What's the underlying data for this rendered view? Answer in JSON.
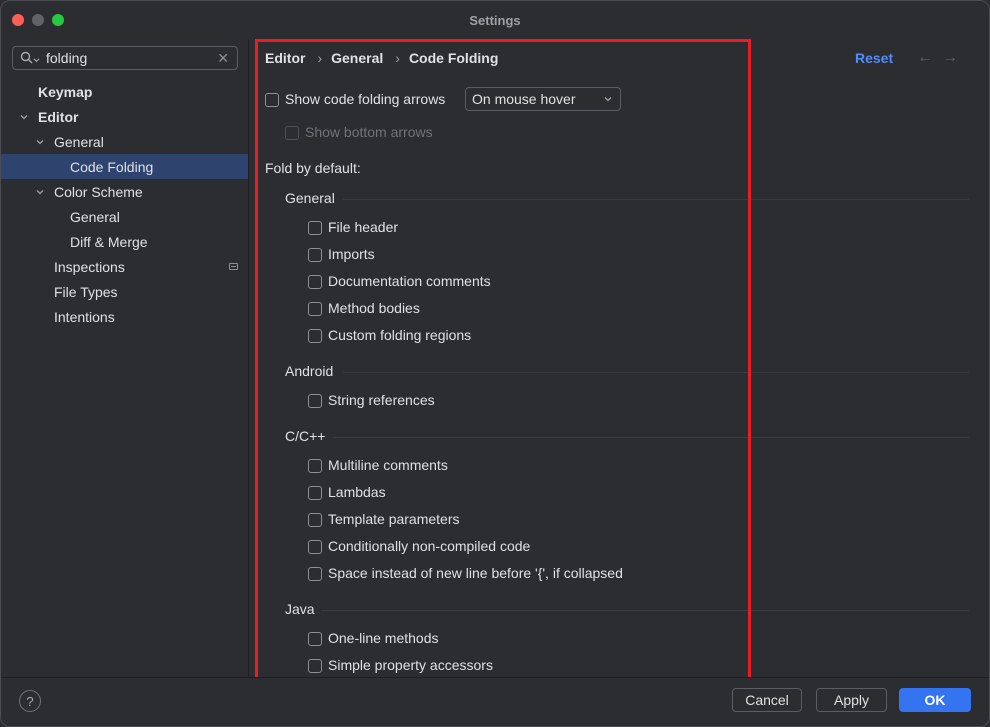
{
  "window": {
    "title": "Settings"
  },
  "colors": {
    "close": "#ff5f57",
    "minimize": "#5f6266",
    "zoom": "#28c840",
    "accent": "#3574f0",
    "selection": "#2e436e",
    "highlight": "#ec1c24"
  },
  "search": {
    "value": "folding",
    "placeholder": ""
  },
  "sidebar": {
    "items": [
      {
        "label": "Keymap"
      },
      {
        "label": "Editor"
      },
      {
        "label": "General"
      },
      {
        "label": "Code Folding"
      },
      {
        "label": "Color Scheme"
      },
      {
        "label": "General"
      },
      {
        "label": "Diff & Merge"
      },
      {
        "label": "Inspections"
      },
      {
        "label": "File Types"
      },
      {
        "label": "Intentions"
      }
    ]
  },
  "breadcrumb": {
    "items": [
      "Editor",
      "General",
      "Code Folding"
    ]
  },
  "header": {
    "reset_label": "Reset",
    "back_icon": "arrow-left-icon",
    "forward_icon": "arrow-right-icon"
  },
  "options": {
    "show_arrows": {
      "label": "Show code folding arrows",
      "checked": false
    },
    "arrows_mode": {
      "selected": "On mouse hover"
    },
    "show_bottom": {
      "label": "Show bottom arrows",
      "checked": false,
      "enabled": false
    }
  },
  "fold_heading": "Fold by default:",
  "groups": [
    {
      "title": "General",
      "items": [
        "File header",
        "Imports",
        "Documentation comments",
        "Method bodies",
        "Custom folding regions"
      ]
    },
    {
      "title": "Android",
      "items": [
        "String references"
      ]
    },
    {
      "title": "C/C++",
      "items": [
        "Multiline comments",
        "Lambdas",
        "Template parameters",
        "Conditionally non-compiled code",
        "Space instead of new line before '{', if collapsed"
      ]
    },
    {
      "title": "Java",
      "items": [
        "One-line methods",
        "Simple property accessors"
      ]
    }
  ],
  "footer": {
    "help": "?",
    "cancel": "Cancel",
    "apply": "Apply",
    "ok": "OK"
  }
}
